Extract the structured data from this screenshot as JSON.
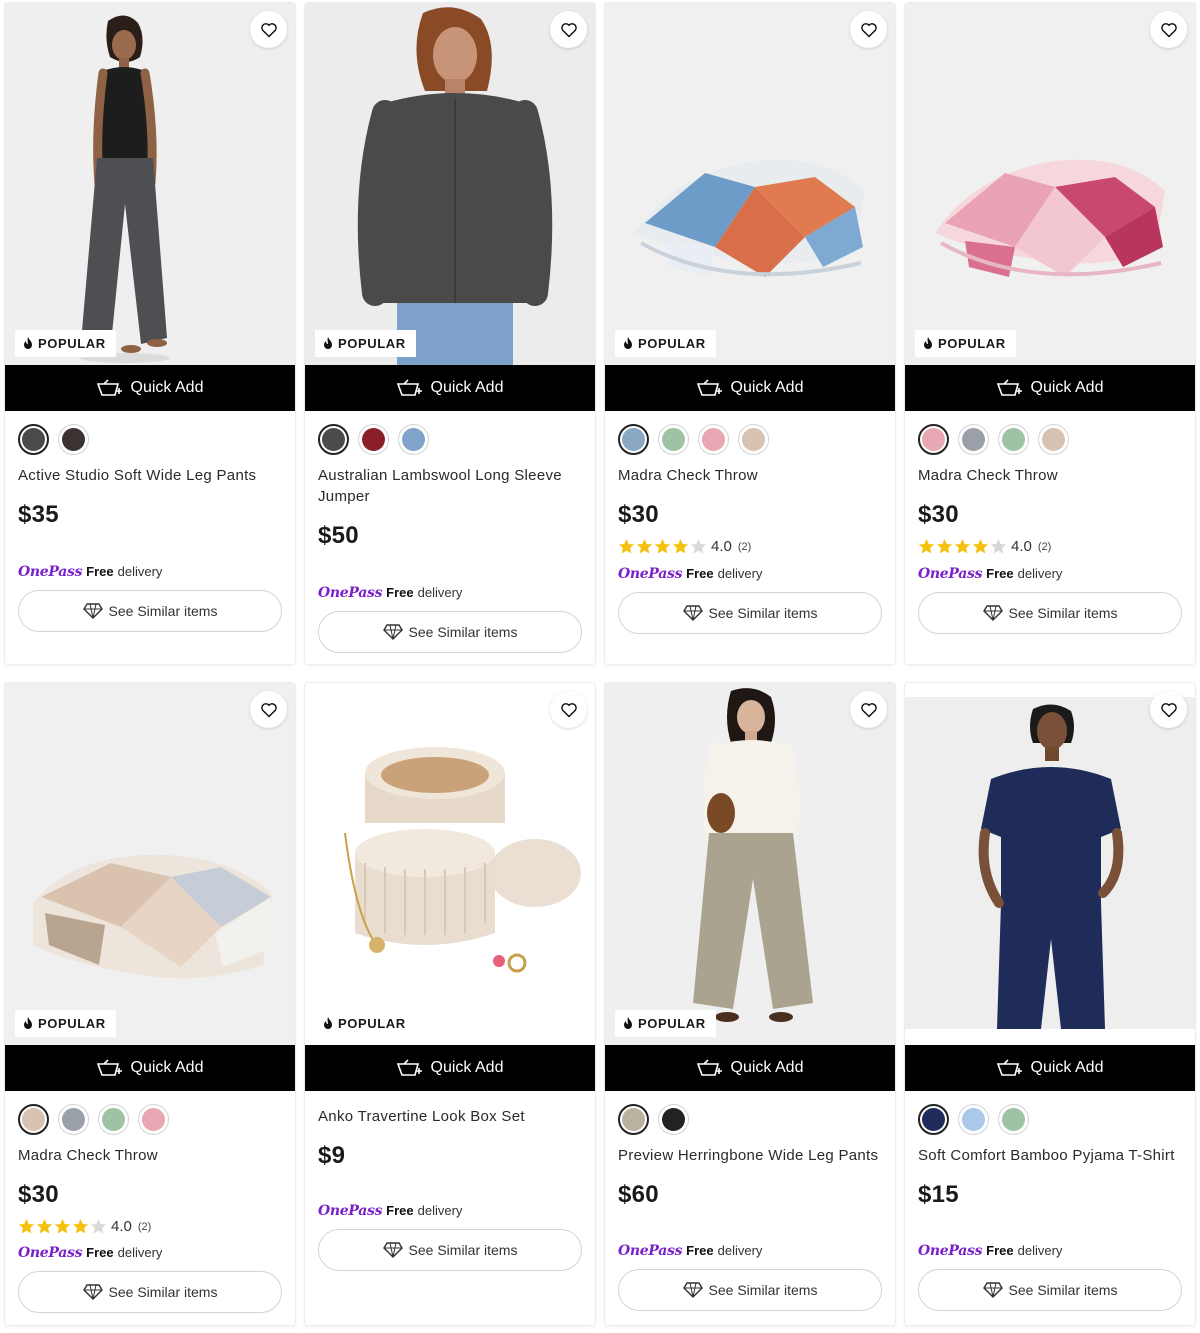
{
  "labels": {
    "popular": "POPULAR",
    "quick_add": "Quick Add",
    "see_similar": "See Similar items",
    "onepass_logo": "OnePass",
    "free": "Free",
    "delivery": "delivery"
  },
  "icons": {
    "favorite": "heart-outline-icon",
    "popular": "flame-icon",
    "quick_add": "basket-icon",
    "similar": "diamond-tag-icon",
    "rating": "star-icon"
  },
  "colors": {
    "accent_onepass": "#7a20c9",
    "star_filled": "#f5c211",
    "star_empty": "#d8d8d8",
    "quick_add_bg": "#000000"
  },
  "products": [
    {
      "title": "Active Studio Soft Wide Leg Pants",
      "price": "$35",
      "popular": true,
      "swatches": [
        "#4a4a4a",
        "#3a3330"
      ],
      "rating": null,
      "reviews": null,
      "image": "woman-grey-wide-leg-pants"
    },
    {
      "title": "Australian Lambswool Long Sleeve Jumper",
      "price": "$50",
      "popular": true,
      "swatches": [
        "#4b4b4b",
        "#8a1f2a",
        "#7fa3c9"
      ],
      "rating": null,
      "reviews": null,
      "image": "woman-charcoal-jumper"
    },
    {
      "title": "Madra Check Throw",
      "price": "$30",
      "popular": true,
      "swatches": [
        "#8aa7c4",
        "#9ec3a4",
        "#e7a7b3",
        "#d8c3b3"
      ],
      "rating": "4.0",
      "reviews": "(2)",
      "stars": 4,
      "image": "blue-orange-check-throw"
    },
    {
      "title": "Madra Check Throw",
      "price": "$30",
      "popular": true,
      "swatches": [
        "#e7a7b3",
        "#9aa0a8",
        "#9ec3a4",
        "#d8c3b3"
      ],
      "rating": "4.0",
      "reviews": "(2)",
      "stars": 4,
      "image": "pink-check-throw"
    },
    {
      "title": "Madra Check Throw",
      "price": "$30",
      "popular": true,
      "swatches": [
        "#d8c3b3",
        "#9aa0a8",
        "#9ec3a4",
        "#e7a7b3"
      ],
      "rating": "4.0",
      "reviews": "(2)",
      "stars": 4,
      "image": "beige-check-throw"
    },
    {
      "title": "Anko Travertine Look Box Set",
      "price": "$9",
      "popular": true,
      "swatches": [],
      "rating": null,
      "reviews": null,
      "image": "travertine-box-set"
    },
    {
      "title": "Preview Herringbone Wide Leg Pants",
      "price": "$60",
      "popular": true,
      "swatches": [
        "#b9b39e",
        "#222222"
      ],
      "rating": null,
      "reviews": null,
      "image": "woman-herringbone-pants"
    },
    {
      "title": "Soft Comfort Bamboo Pyjama T-Shirt",
      "price": "$15",
      "popular": false,
      "swatches": [
        "#1f2c5a",
        "#a9c8ea",
        "#9ec3a4"
      ],
      "rating": null,
      "reviews": null,
      "image": "woman-navy-pyjama"
    }
  ]
}
